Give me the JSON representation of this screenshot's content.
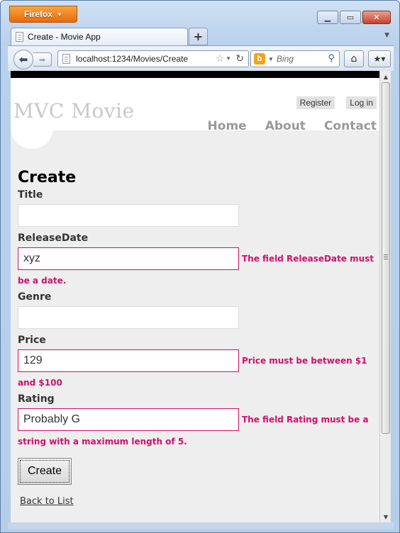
{
  "browser": {
    "menu_button": "Firefox",
    "tab_title": "Create - Movie App",
    "new_tab": "+",
    "url": "localhost:1234/Movies/Create",
    "search_placeholder": "Bing"
  },
  "site": {
    "title": "MVC Movie",
    "auth": {
      "register": "Register",
      "login": "Log in"
    },
    "menu": {
      "home": "Home",
      "about": "About",
      "contact": "Contact"
    }
  },
  "form": {
    "heading": "Create",
    "fields": {
      "title": {
        "label": "Title",
        "value": ""
      },
      "release_date": {
        "label": "ReleaseDate",
        "value": "xyz",
        "error_line1": "The field ReleaseDate must",
        "error_line2": "be a date."
      },
      "genre": {
        "label": "Genre",
        "value": ""
      },
      "price": {
        "label": "Price",
        "value": "129",
        "error_line1": "Price must be between $1",
        "error_line2": "and $100"
      },
      "rating": {
        "label": "Rating",
        "value": "Probably G",
        "error_line1": "The field Rating must be a",
        "error_line2": "string with a maximum length of 5."
      }
    },
    "submit": "Create",
    "back_link": "Back to List"
  },
  "colors": {
    "error": "#d0106b",
    "header_text": "#c8c8c8",
    "menu_text": "#999999",
    "firefox_orange": "#e86a10"
  }
}
